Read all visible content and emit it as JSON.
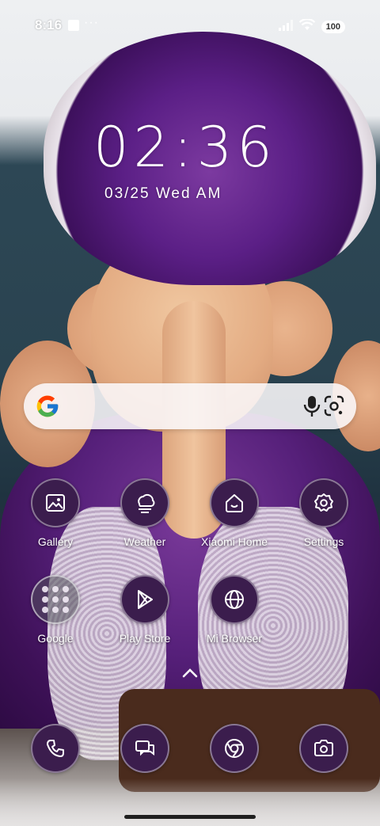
{
  "status_bar": {
    "time": "8:16",
    "more": "···",
    "battery": "100"
  },
  "clock_widget": {
    "time": "02:36",
    "date": "03/25 Wed AM"
  },
  "search_bar": {
    "placeholder": ""
  },
  "apps_row1": [
    {
      "label": "Gallery",
      "icon": "gallery-icon"
    },
    {
      "label": "Weather",
      "icon": "weather-icon"
    },
    {
      "label": "Xiaomi Home",
      "icon": "xiaomi-home-icon"
    },
    {
      "label": "Settings",
      "icon": "gear-icon"
    }
  ],
  "apps_row2": [
    {
      "label": "Google",
      "icon": "folder-icon"
    },
    {
      "label": "Play Store",
      "icon": "play-store-icon"
    },
    {
      "label": "Mi Browser",
      "icon": "globe-icon"
    }
  ],
  "dock": [
    {
      "icon": "phone-icon"
    },
    {
      "icon": "messages-icon"
    },
    {
      "icon": "chrome-icon"
    },
    {
      "icon": "camera-icon"
    }
  ],
  "colors": {
    "icon_bg": "#3b1d4d",
    "accent_purple": "#5b1f86"
  }
}
